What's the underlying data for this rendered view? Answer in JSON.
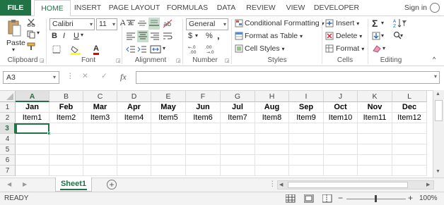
{
  "tabs": {
    "file": "FILE",
    "home": "HOME",
    "insert": "INSERT",
    "page_layout": "PAGE LAYOUT",
    "formulas": "FORMULAS",
    "data": "DATA",
    "review": "REVIEW",
    "view": "VIEW",
    "developer": "DEVELOPER",
    "sign_in": "Sign in"
  },
  "ribbon": {
    "clipboard": {
      "paste": "Paste",
      "label": "Clipboard"
    },
    "font": {
      "name": "Calibri",
      "size": "11",
      "bold": "B",
      "italic": "I",
      "underline": "U",
      "grow": "A",
      "shrink": "A",
      "label": "Font"
    },
    "alignment": {
      "label": "Alignment"
    },
    "number": {
      "format": "General",
      "currency": "$",
      "percent": "%",
      "comma": ",",
      "label": "Number"
    },
    "styles": {
      "conditional": "Conditional Formatting",
      "format_table": "Format as Table",
      "cell_styles": "Cell Styles",
      "label": "Styles"
    },
    "cells": {
      "insert": "Insert",
      "delete": "Delete",
      "format": "Format",
      "label": "Cells"
    },
    "editing": {
      "label": "Editing"
    }
  },
  "formula_bar": {
    "name_box": "A3",
    "fx": "fx",
    "value": ""
  },
  "sheet": {
    "columns": [
      "A",
      "B",
      "C",
      "D",
      "E",
      "F",
      "G",
      "H",
      "I",
      "J",
      "K",
      "L"
    ],
    "rows": [
      "1",
      "2",
      "3",
      "4",
      "5",
      "6",
      "7"
    ],
    "row1": [
      "Jan",
      "Feb",
      "Mar",
      "Apr",
      "May",
      "Jun",
      "Jul",
      "Aug",
      "Sep",
      "Oct",
      "Nov",
      "Dec"
    ],
    "row2": [
      "Item1",
      "Item2",
      "Item3",
      "Item4",
      "Item5",
      "Item6",
      "Item7",
      "Item8",
      "Item9",
      "Item10",
      "Item11",
      "Item12"
    ],
    "active_cell": "A3"
  },
  "sheet_tabs": {
    "active": "Sheet1",
    "add": "+"
  },
  "status": {
    "ready": "READY",
    "zoom": "100%",
    "minus": "−",
    "plus": "+"
  },
  "colors": {
    "accent": "#217346",
    "selection": "#217346"
  }
}
